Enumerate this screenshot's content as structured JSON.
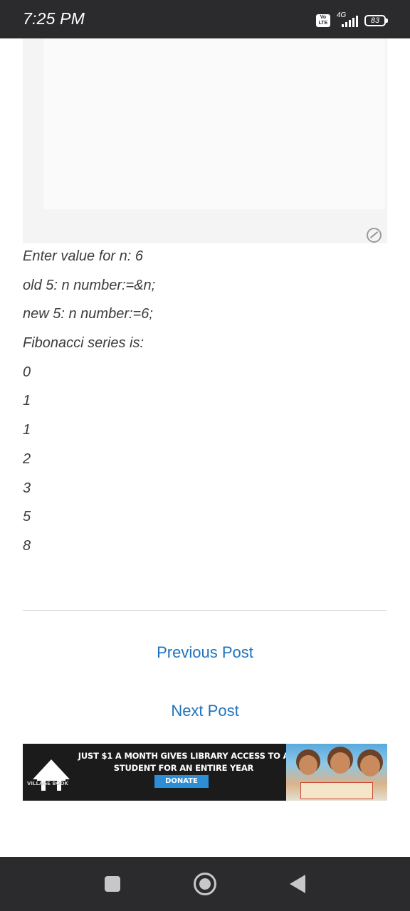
{
  "status_bar": {
    "time": "7:25 PM",
    "volte": "Vo LTE",
    "network": "4G",
    "battery": "83"
  },
  "output": {
    "lines": [
      "Enter value for n: 6",
      "old 5: n number:=&n;",
      "new 5: n number:=6;",
      "Fibonacci series is:",
      "0",
      "1",
      "1",
      "2",
      "3",
      "5",
      "8"
    ]
  },
  "navigation": {
    "previous_label": "Previous Post",
    "next_label": "Next Post"
  },
  "banner": {
    "headline": "JUST $1 A MONTH GIVES LIBRARY ACCESS TO A STUDENT FOR AN ENTIRE YEAR",
    "donate_label": "DONATE",
    "logo_text": "VILLAGE BOOK"
  },
  "colors": {
    "link": "#1e73be",
    "status_bar": "#2b2b2d",
    "donate": "#2c8ed6"
  }
}
